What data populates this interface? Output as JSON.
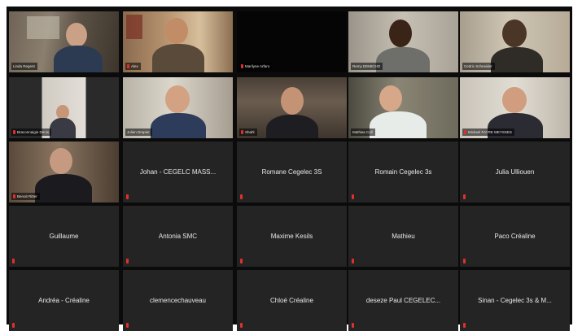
{
  "meeting": {
    "video_tiles": [
      {
        "name": "Linda Regent",
        "muted": false,
        "highlight": false
      },
      {
        "name": "Alex",
        "muted": true,
        "highlight": false
      },
      {
        "name": "Marilyne Arfaro",
        "muted": true,
        "highlight": false
      },
      {
        "name": "Remy DEMICHO",
        "muted": false,
        "highlight": false
      },
      {
        "name": "Cedric Schneider",
        "muted": false,
        "highlight": true
      },
      {
        "name": "Braconnaigie Denis",
        "muted": true,
        "highlight": false
      },
      {
        "name": "Julien Drapier",
        "muted": false,
        "highlight": false
      },
      {
        "name": "Shahl",
        "muted": true,
        "highlight": false
      },
      {
        "name": "Mathias Coll",
        "muted": false,
        "highlight": false
      },
      {
        "name": "Mickael FAYRE MEYSSES",
        "muted": true,
        "highlight": false
      },
      {
        "name": "Benoit Ritter",
        "muted": true,
        "highlight": false
      }
    ],
    "name_tiles": [
      "Johan - CEGELC MASS...",
      "Romane Cegelec 3S",
      "Romain Cegelec 3s",
      "Julia Ulliouen",
      "Guillaume",
      "Antonia SMC",
      "Maxime Kesils",
      "Mathieu",
      "Paco Créaline",
      "Andréa - Créaline",
      "clemencechauveau",
      "Chloé Créaline",
      "deseze Paul CEGELEC...",
      "Sinan - Cegelec 3s & M..."
    ]
  }
}
